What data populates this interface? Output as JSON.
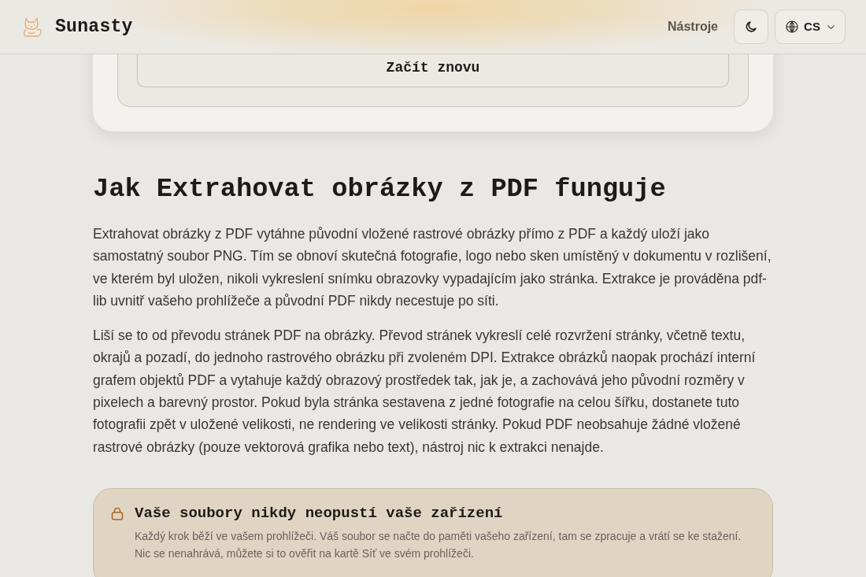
{
  "header": {
    "brand": "Sunasty",
    "nav": [
      {
        "label": "Nástroje"
      }
    ],
    "language": "CS"
  },
  "tool_card": {
    "restart_button": "Začít znovu"
  },
  "article": {
    "heading": "Jak Extrahovat obrázky z PDF funguje",
    "paragraphs": [
      "Extrahovat obrázky z PDF vytáhne původní vložené rastrové obrázky přímo z PDF a každý uloží jako samostatný soubor PNG. Tím se obnoví skutečná fotografie, logo nebo sken umístěný v dokumentu v rozlišení, ve kterém byl uložen, nikoli vykreslení snímku obrazovky vypadajícím jako stránka. Extrakce je prováděna pdf-lib uvnitř vašeho prohlížeče a původní PDF nikdy necestuje po síti.",
      "Liší se to od převodu stránek PDF na obrázky. Převod stránek vykreslí celé rozvržení stránky, včetně textu, okrajů a pozadí, do jednoho rastrového obrázku při zvoleném DPI. Extrakce obrázků naopak prochází interní grafem objektů PDF a vytahuje každý obrazový prostředek tak, jak je, a zachovává jeho původní rozměry v pixelech a barevný prostor. Pokud byla stránka sestavena z jedné fotografie na celou šířku, dostanete tuto fotografii zpět v uložené velikosti, ne rendering ve velikosti stránky. Pokud PDF neobsahuje žádné vložené rastrové obrázky (pouze vektorová grafika nebo text), nástroj nic k extrakci nenajde."
    ]
  },
  "privacy_notice": {
    "title": "Vaše soubory nikdy neopustí vaše zařízení",
    "text": "Každý krok běží ve vašem prohlížeči. Váš soubor se načte do paměti vašeho zařízení, tam se zpracuje a vrátí se ke stažení. Nic se nenahrává, můžete si to ověřit na kartě Síť ve svém prohlížeči."
  }
}
